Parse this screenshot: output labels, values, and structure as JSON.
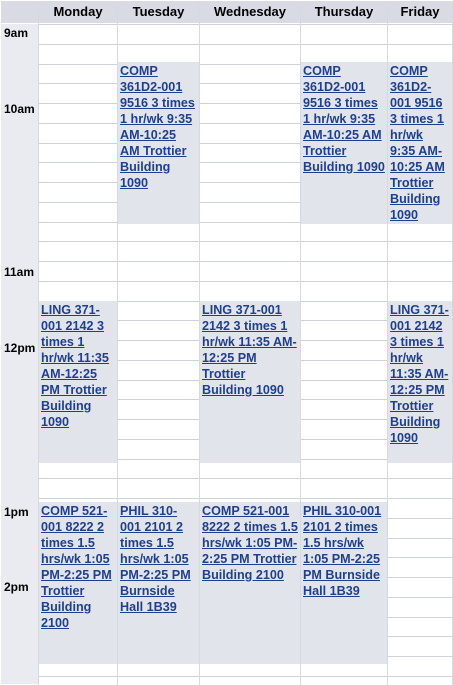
{
  "header": {
    "days": [
      "Monday",
      "Tuesday",
      "Wednesday",
      "Thursday",
      "Friday"
    ]
  },
  "times": {
    "t9": "9am",
    "t10": "10am",
    "t11": "11am",
    "t12": "12pm",
    "t1": "1pm",
    "t2": "2pm"
  },
  "events": {
    "comp361_tue": "COMP 361D2-001 9516 3 times 1 hr/wk 9:35 AM-10:25 AM Trottier Building 1090",
    "comp361_thu": "COMP 361D2-001 9516 3 times 1 hr/wk 9:35 AM-10:25 AM Trottier Building 1090",
    "comp361_fri": "COMP 361D2-001 9516 3 times 1 hr/wk 9:35 AM-10:25 AM Trottier Building 1090",
    "ling371_mon": "LING 371-001 2142 3 times 1 hr/wk 11:35 AM-12:25 PM Trottier Building 1090",
    "ling371_wed": "LING 371-001 2142 3 times 1 hr/wk 11:35 AM-12:25 PM Trottier Building 1090",
    "ling371_fri": "LING 371-001 2142 3 times 1 hr/wk 11:35 AM-12:25 PM Trottier Building 1090",
    "comp521_mon": "COMP 521-001 8222 2 times 1.5 hrs/wk 1:05 PM-2:25 PM Trottier Building 2100",
    "comp521_wed": "COMP 521-001 8222 2 times 1.5 hrs/wk 1:05 PM-2:25 PM Trottier Building 2100",
    "phil310_tue": "PHIL 310-001 2101 2 times 1.5 hrs/wk 1:05 PM-2:25 PM Burnside Hall 1B39",
    "phil310_thu": "PHIL 310-001 2101 2 times 1.5 hrs/wk 1:05 PM-2:25 PM Burnside Hall 1B39"
  }
}
